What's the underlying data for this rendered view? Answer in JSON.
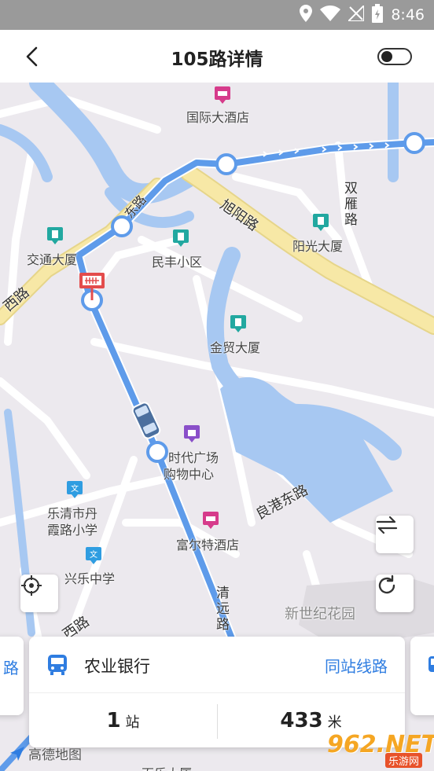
{
  "status_bar": {
    "time": "8:46"
  },
  "header": {
    "title": "105路详情"
  },
  "map": {
    "road_labels": {
      "dongdong": "东路",
      "xuyang": "旭阳路",
      "shuangyan": "双\n雁\n路",
      "lianggang": "良港东路",
      "qingyuan": "清\n远\n路",
      "xilu_left": "西路",
      "xilu_bottom": "西路"
    },
    "pois": {
      "guoji": "国际大酒店",
      "jiaotong": "交通大厦",
      "minfeng": "民丰小区",
      "yangguang": "阳光大厦",
      "jinmao": "金贸大厦",
      "shidai_1": "时代广场",
      "shidai_2": "购物中心",
      "danxia_1": "乐清市丹",
      "danxia_2": "霞路小学",
      "fuerte": "富尔特酒店",
      "xingle": "兴乐中学",
      "xinshiji": "新世纪花园",
      "baile": "百乐大厦"
    }
  },
  "card": {
    "station": "农业银行",
    "link": "同站线路",
    "stops_value": "1",
    "stops_unit": "站",
    "distance_value": "433",
    "distance_unit": "米"
  },
  "side_cards": {
    "left_text": "路"
  },
  "footer": {
    "amap_logo": "高德地图",
    "watermark_main": "962.NET",
    "watermark_sub": "乐游网"
  },
  "colors": {
    "route": "#5e9bea",
    "water": "#a7c8f2",
    "road_major": "#f7e8a6",
    "accent": "#2f7de1"
  }
}
